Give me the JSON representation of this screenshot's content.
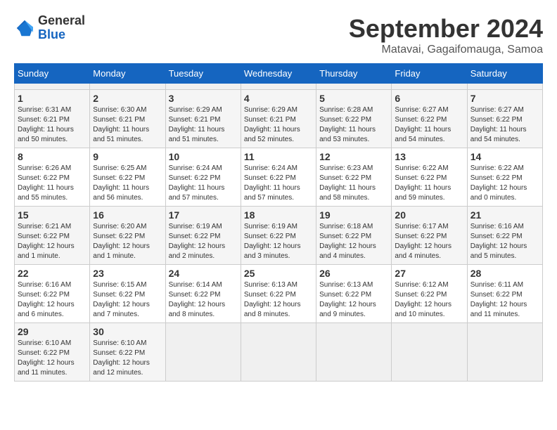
{
  "header": {
    "logo": {
      "line1": "General",
      "line2": "Blue"
    },
    "title": "September 2024",
    "subtitle": "Matavai, Gagaifomauga, Samoa"
  },
  "calendar": {
    "days_of_week": [
      "Sunday",
      "Monday",
      "Tuesday",
      "Wednesday",
      "Thursday",
      "Friday",
      "Saturday"
    ],
    "weeks": [
      [
        null,
        null,
        null,
        null,
        null,
        null,
        null
      ]
    ]
  },
  "cells": [
    {
      "day": null
    },
    {
      "day": null
    },
    {
      "day": null
    },
    {
      "day": null
    },
    {
      "day": null
    },
    {
      "day": null
    },
    {
      "day": null
    },
    {
      "day": 1,
      "sunrise": "6:31 AM",
      "sunset": "6:21 PM",
      "daylight": "11 hours and 50 minutes."
    },
    {
      "day": 2,
      "sunrise": "6:30 AM",
      "sunset": "6:21 PM",
      "daylight": "11 hours and 51 minutes."
    },
    {
      "day": 3,
      "sunrise": "6:29 AM",
      "sunset": "6:21 PM",
      "daylight": "11 hours and 51 minutes."
    },
    {
      "day": 4,
      "sunrise": "6:29 AM",
      "sunset": "6:21 PM",
      "daylight": "11 hours and 52 minutes."
    },
    {
      "day": 5,
      "sunrise": "6:28 AM",
      "sunset": "6:22 PM",
      "daylight": "11 hours and 53 minutes."
    },
    {
      "day": 6,
      "sunrise": "6:27 AM",
      "sunset": "6:22 PM",
      "daylight": "11 hours and 54 minutes."
    },
    {
      "day": 7,
      "sunrise": "6:27 AM",
      "sunset": "6:22 PM",
      "daylight": "11 hours and 54 minutes."
    },
    {
      "day": 8,
      "sunrise": "6:26 AM",
      "sunset": "6:22 PM",
      "daylight": "11 hours and 55 minutes."
    },
    {
      "day": 9,
      "sunrise": "6:25 AM",
      "sunset": "6:22 PM",
      "daylight": "11 hours and 56 minutes."
    },
    {
      "day": 10,
      "sunrise": "6:24 AM",
      "sunset": "6:22 PM",
      "daylight": "11 hours and 57 minutes."
    },
    {
      "day": 11,
      "sunrise": "6:24 AM",
      "sunset": "6:22 PM",
      "daylight": "11 hours and 57 minutes."
    },
    {
      "day": 12,
      "sunrise": "6:23 AM",
      "sunset": "6:22 PM",
      "daylight": "11 hours and 58 minutes."
    },
    {
      "day": 13,
      "sunrise": "6:22 AM",
      "sunset": "6:22 PM",
      "daylight": "11 hours and 59 minutes."
    },
    {
      "day": 14,
      "sunrise": "6:22 AM",
      "sunset": "6:22 PM",
      "daylight": "12 hours and 0 minutes."
    },
    {
      "day": 15,
      "sunrise": "6:21 AM",
      "sunset": "6:22 PM",
      "daylight": "12 hours and 1 minute."
    },
    {
      "day": 16,
      "sunrise": "6:20 AM",
      "sunset": "6:22 PM",
      "daylight": "12 hours and 1 minute."
    },
    {
      "day": 17,
      "sunrise": "6:19 AM",
      "sunset": "6:22 PM",
      "daylight": "12 hours and 2 minutes."
    },
    {
      "day": 18,
      "sunrise": "6:19 AM",
      "sunset": "6:22 PM",
      "daylight": "12 hours and 3 minutes."
    },
    {
      "day": 19,
      "sunrise": "6:18 AM",
      "sunset": "6:22 PM",
      "daylight": "12 hours and 4 minutes."
    },
    {
      "day": 20,
      "sunrise": "6:17 AM",
      "sunset": "6:22 PM",
      "daylight": "12 hours and 4 minutes."
    },
    {
      "day": 21,
      "sunrise": "6:16 AM",
      "sunset": "6:22 PM",
      "daylight": "12 hours and 5 minutes."
    },
    {
      "day": 22,
      "sunrise": "6:16 AM",
      "sunset": "6:22 PM",
      "daylight": "12 hours and 6 minutes."
    },
    {
      "day": 23,
      "sunrise": "6:15 AM",
      "sunset": "6:22 PM",
      "daylight": "12 hours and 7 minutes."
    },
    {
      "day": 24,
      "sunrise": "6:14 AM",
      "sunset": "6:22 PM",
      "daylight": "12 hours and 8 minutes."
    },
    {
      "day": 25,
      "sunrise": "6:13 AM",
      "sunset": "6:22 PM",
      "daylight": "12 hours and 8 minutes."
    },
    {
      "day": 26,
      "sunrise": "6:13 AM",
      "sunset": "6:22 PM",
      "daylight": "12 hours and 9 minutes."
    },
    {
      "day": 27,
      "sunrise": "6:12 AM",
      "sunset": "6:22 PM",
      "daylight": "12 hours and 10 minutes."
    },
    {
      "day": 28,
      "sunrise": "6:11 AM",
      "sunset": "6:22 PM",
      "daylight": "12 hours and 11 minutes."
    },
    {
      "day": 29,
      "sunrise": "6:10 AM",
      "sunset": "6:22 PM",
      "daylight": "12 hours and 11 minutes."
    },
    {
      "day": 30,
      "sunrise": "6:10 AM",
      "sunset": "6:22 PM",
      "daylight": "12 hours and 12 minutes."
    },
    {
      "day": null
    },
    {
      "day": null
    },
    {
      "day": null
    },
    {
      "day": null
    },
    {
      "day": null
    }
  ],
  "labels": {
    "sunrise_prefix": "Sunrise: ",
    "sunset_prefix": "Sunset: ",
    "daylight_prefix": "Daylight: "
  }
}
